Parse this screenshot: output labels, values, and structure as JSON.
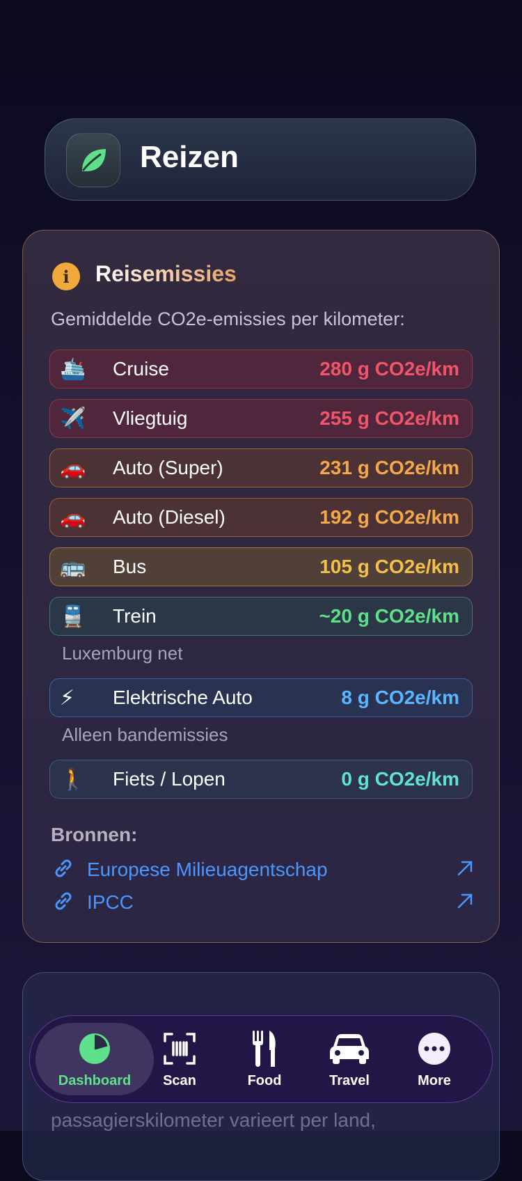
{
  "header": {
    "title": "Reizen",
    "icon": "leaf-icon"
  },
  "card": {
    "title": "Reisemissies",
    "subtitle": "Gemiddelde CO2e-emissies per kilometer:",
    "rows": [
      {
        "emoji": "🛳️",
        "label": "Cruise",
        "value": "280 g CO2e/km"
      },
      {
        "emoji": "✈️",
        "label": "Vliegtuig",
        "value": "255 g CO2e/km"
      },
      {
        "emoji": "🚗",
        "label": "Auto (Super)",
        "value": "231 g CO2e/km"
      },
      {
        "emoji": "🚗",
        "label": "Auto (Diesel)",
        "value": "192 g CO2e/km"
      },
      {
        "emoji": "🚌",
        "label": "Bus",
        "value": "105 g CO2e/km"
      },
      {
        "emoji": "🚆",
        "label": "Trein",
        "value": "~20 g CO2e/km"
      },
      {
        "emoji": "⚡",
        "label": "Elektrische Auto",
        "value": "8 g CO2e/km"
      },
      {
        "emoji": "🚶",
        "label": "Fiets / Lopen",
        "value": "0 g CO2e/km"
      }
    ],
    "notes": {
      "train": "Luxemburg net",
      "ev": "Alleen bandemissies"
    },
    "sources_label": "Bronnen:",
    "sources": [
      {
        "label": "Europese Milieuagentschap"
      },
      {
        "label": "IPCC"
      }
    ]
  },
  "card2": {
    "text": "passagierskilometer varieert per land,"
  },
  "tabbar": {
    "tabs": [
      {
        "label": "Dashboard",
        "icon": "pie-chart-icon",
        "active": true
      },
      {
        "label": "Scan",
        "icon": "barcode-scan-icon"
      },
      {
        "label": "Food",
        "icon": "fork-knife-icon"
      },
      {
        "label": "Travel",
        "icon": "car-icon"
      },
      {
        "label": "More",
        "icon": "ellipsis-icon"
      }
    ]
  },
  "colors": {
    "high": "#f0566a",
    "medium": "#f3a94a",
    "low": "#5fe08a",
    "ev": "#5ab6ff",
    "zero": "#5fe3d2",
    "link": "#4a98ff",
    "accent": "#f2a93b"
  }
}
